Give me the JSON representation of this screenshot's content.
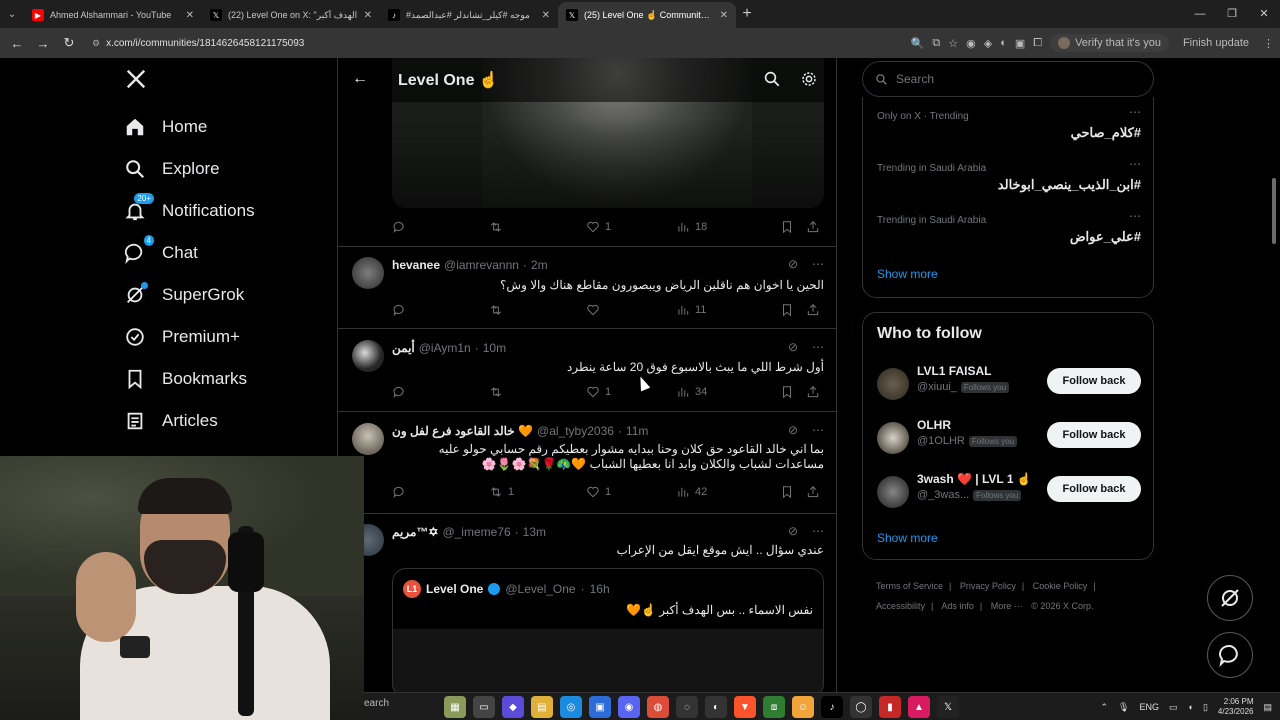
{
  "browser": {
    "tabs": [
      {
        "title": "Ahmed Alshammari - YouTube",
        "icon": "youtube-icon",
        "color": "#ff0000"
      },
      {
        "title": "(22) Level One on X: \"الهدف أكبر",
        "icon": "x-icon",
        "color": "#000000"
      },
      {
        "title": "#موجه #كيلر_تشاندلر #عبدالصمد",
        "icon": "tiktok-icon",
        "color": "#000000"
      },
      {
        "title": "(25) Level One ☝️ Community / X",
        "icon": "x-icon",
        "color": "#000000"
      }
    ],
    "url": "x.com/i/communities/1814626458121175093",
    "verify_label": "Verify that it's you",
    "finish_label": "Finish update"
  },
  "nav": {
    "items": [
      {
        "label": "Home",
        "icon": "home-icon"
      },
      {
        "label": "Explore",
        "icon": "search-icon"
      },
      {
        "label": "Notifications",
        "icon": "bell-icon",
        "badge": "20+"
      },
      {
        "label": "Chat",
        "icon": "chat-icon",
        "badge": "4"
      },
      {
        "label": "SuperGrok",
        "icon": "grok-icon"
      },
      {
        "label": "Premium+",
        "icon": "premium-icon"
      },
      {
        "label": "Bookmarks",
        "icon": "bookmark-icon"
      },
      {
        "label": "Articles",
        "icon": "articles-icon"
      }
    ]
  },
  "community": {
    "title": "Level One ☝️"
  },
  "feed": {
    "first_actions": {
      "likes": "1",
      "views": "18"
    },
    "tweets": [
      {
        "name": "hevanee",
        "handle": "@iamrevannn",
        "time": "2m",
        "text": "الحين يا اخوان هم ناقلين الرياض ويبصورون مقاطع هناك والا وش؟",
        "likes": "",
        "retweets": "",
        "views": "11"
      },
      {
        "name": "أيمن",
        "handle": "@iAym1n",
        "time": "10m",
        "text": "أول شرط اللي ما يبث بالاسبوع فوق 20 ساعة ينطرد",
        "likes": "1",
        "retweets": "",
        "views": "34"
      },
      {
        "name": "خالد القاعود فرع لفل ون 🧡",
        "handle": "@al_tyby2036",
        "time": "11m",
        "text": "بما اني خالد القاعود حق كلان وحنا ببدايه مشوار بعطيكم رقم حسابي حولو عليه مساعدات لشباب والكلان وابد انا بعطيها الشباب 🧡🦚🌹💐🌸🌷🌸",
        "likes": "1",
        "retweets": "1",
        "views": "42"
      },
      {
        "name": "مريم™✡",
        "handle": "@_imeme76",
        "time": "13m",
        "text": "عندي سؤال .. ايش موقع ايقل من الإعراب",
        "likes": "",
        "retweets": "",
        "views": ""
      }
    ],
    "quote": {
      "name": "Level One",
      "handle": "@Level_One",
      "time": "16h",
      "text": "نفس الاسماء .. بس الهدف أكبر ☝️🧡"
    }
  },
  "right": {
    "search_placeholder": "Search",
    "trends": [
      {
        "context": "Only on X · Trending",
        "tag": "#كلام_صاحي"
      },
      {
        "context": "Trending in Saudi Arabia",
        "tag": "#ابن_الذيب_ينصي_ابوخالد"
      },
      {
        "context": "Trending in Saudi Arabia",
        "tag": "#علي_عواض"
      }
    ],
    "show_more": "Show more",
    "who_to_follow_title": "Who to follow",
    "follows": [
      {
        "name": "LVL1 FAISAL",
        "handle": "@xiuui_",
        "badge": "Follows you",
        "button": "Follow back"
      },
      {
        "name": "OLHR",
        "handle": "@1OLHR",
        "badge": "Follows you",
        "button": "Follow back"
      },
      {
        "name": "3wash ❤️ | LVL 1 ☝️",
        "handle": "@_3was...",
        "badge": "Follows you",
        "button": "Follow back"
      }
    ],
    "show_more_2": "Show more",
    "footer": {
      "links": [
        "Terms of Service",
        "Privacy Policy",
        "Cookie Policy",
        "Accessibility",
        "Ads info",
        "More ⋯"
      ],
      "copyright": "© 2026 X Corp."
    }
  },
  "taskbar": {
    "search": "earch",
    "lang": "ENG",
    "time": "2:06 PM",
    "date": "4/23/2026"
  },
  "colors": {
    "accent": "#1d9bf0",
    "background": "#000000",
    "border": "#2f3336",
    "muted": "#71767b"
  }
}
